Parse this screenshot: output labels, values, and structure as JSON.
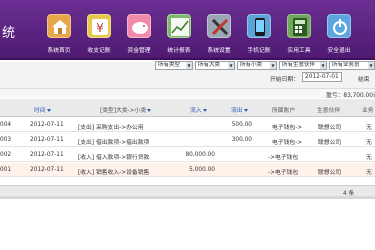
{
  "header": {
    "app_title": "统",
    "nav": [
      {
        "label": "系统首页",
        "icon": "home-icon",
        "color": "#e8a64a"
      },
      {
        "label": "收支记账",
        "icon": "yen-icon",
        "color": "#e6c84a"
      },
      {
        "label": "资金管理",
        "icon": "piggy-bank-icon",
        "color": "#f08aa8"
      },
      {
        "label": "统计报表",
        "icon": "chart-icon",
        "color": "#7fb86b"
      },
      {
        "label": "系统设置",
        "icon": "tools-icon",
        "color": "#9aa6b4"
      },
      {
        "label": "手机记账",
        "icon": "phone-icon",
        "color": "#5ca3d8"
      },
      {
        "label": "实用工具",
        "icon": "calculator-icon",
        "color": "#6fa85a"
      },
      {
        "label": "安全退出",
        "icon": "power-icon",
        "color": "#5ba6e0"
      }
    ]
  },
  "filters": {
    "selects": [
      "所有类型",
      "所有大类",
      "所有小类",
      "所有生意伙伴",
      "所有业务员"
    ],
    "start_date_label": "开始日期：",
    "start_date": "2012-07-01",
    "end_date_label": "结束"
  },
  "balance": {
    "text": "盈亏：83,700.00元"
  },
  "table": {
    "columns": {
      "time": "时间",
      "category": "[类型]大类->小类",
      "income": "流入",
      "expense": "流出",
      "account": "所属账户",
      "partner": "生意伙伴",
      "staff": "业务"
    },
    "rows": [
      {
        "id": "004",
        "time": "2012-07-11",
        "category": "[支出] 采购支出->办公用",
        "income": "",
        "expense": "500.00",
        "account": "电子钱包->",
        "partner": "联想公司",
        "staff": "无"
      },
      {
        "id": "003",
        "time": "2012-07-11",
        "category": "[支出] 借出款项->借出款项",
        "income": "",
        "expense": "300.00",
        "account": "电子钱包->",
        "partner": "联想公司",
        "staff": "无"
      },
      {
        "id": "002",
        "time": "2012-07-11",
        "category": "[收入] 借入款项->银行贷款",
        "income": "80,000.00",
        "expense": "",
        "account": "->电子钱包",
        "partner": "",
        "staff": "无"
      },
      {
        "id": "001",
        "time": "2012-07-11",
        "category": "[收入] 销售收入->设备销售",
        "income": "5,000.00",
        "expense": "",
        "account": "->电子钱包",
        "partner": "联想公司",
        "staff": "无"
      }
    ],
    "footer_count": "4 条"
  },
  "colors": {
    "header_bg": "#5a2181",
    "link_blue": "#2e5cb8",
    "row_highlight": "#fff2ea"
  }
}
